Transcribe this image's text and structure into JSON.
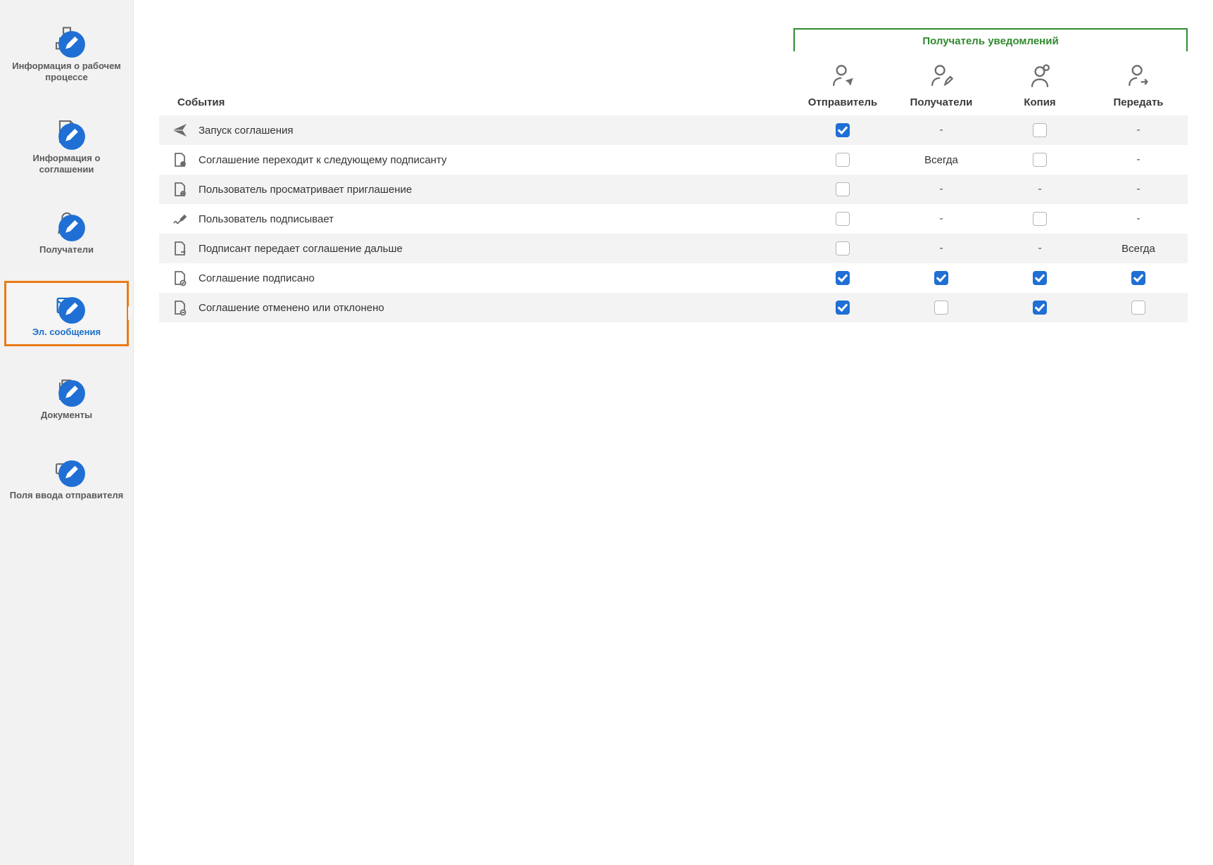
{
  "sidebar": {
    "items": [
      {
        "id": "workflow-info",
        "label": "Информация о рабочем процессе"
      },
      {
        "id": "agreement-info",
        "label": "Информация о соглашении"
      },
      {
        "id": "recipients",
        "label": "Получатели"
      },
      {
        "id": "emails",
        "label": "Эл. сообщения",
        "active": true
      },
      {
        "id": "documents",
        "label": "Документы"
      },
      {
        "id": "sender-fields",
        "label": "Поля ввода отправителя"
      }
    ]
  },
  "table": {
    "recipient_group_label": "Получатель уведомлений",
    "events_header": "События",
    "columns": [
      {
        "id": "sender",
        "label": "Отправитель"
      },
      {
        "id": "recipients",
        "label": "Получатели"
      },
      {
        "id": "cc",
        "label": "Копия"
      },
      {
        "id": "forward",
        "label": "Передать"
      }
    ],
    "always_text": "Всегда",
    "rows": [
      {
        "icon": "send",
        "label": "Запуск соглашения",
        "cells": [
          {
            "type": "checkbox",
            "checked": true
          },
          {
            "type": "dash"
          },
          {
            "type": "checkbox",
            "checked": false
          },
          {
            "type": "dash"
          }
        ]
      },
      {
        "icon": "next-signer",
        "label": "Соглашение переходит к следующему подписанту",
        "cells": [
          {
            "type": "checkbox",
            "checked": false
          },
          {
            "type": "text",
            "value": "Всегда"
          },
          {
            "type": "checkbox",
            "checked": false
          },
          {
            "type": "dash"
          }
        ]
      },
      {
        "icon": "view",
        "label": "Пользователь просматривает приглашение",
        "cells": [
          {
            "type": "checkbox",
            "checked": false
          },
          {
            "type": "dash"
          },
          {
            "type": "dash"
          },
          {
            "type": "dash"
          }
        ]
      },
      {
        "icon": "sign",
        "label": "Пользователь подписывает",
        "cells": [
          {
            "type": "checkbox",
            "checked": false
          },
          {
            "type": "dash"
          },
          {
            "type": "checkbox",
            "checked": false
          },
          {
            "type": "dash"
          }
        ]
      },
      {
        "icon": "delegate",
        "label": "Подписант передает соглашение дальше",
        "cells": [
          {
            "type": "checkbox",
            "checked": false
          },
          {
            "type": "dash"
          },
          {
            "type": "dash"
          },
          {
            "type": "text",
            "value": "Всегда"
          }
        ]
      },
      {
        "icon": "signed",
        "label": "Соглашение подписано",
        "cells": [
          {
            "type": "checkbox",
            "checked": true
          },
          {
            "type": "checkbox",
            "checked": true
          },
          {
            "type": "checkbox",
            "checked": true
          },
          {
            "type": "checkbox",
            "checked": true
          }
        ]
      },
      {
        "icon": "cancelled",
        "label": "Соглашение отменено или отклонено",
        "cells": [
          {
            "type": "checkbox",
            "checked": true
          },
          {
            "type": "checkbox",
            "checked": false
          },
          {
            "type": "checkbox",
            "checked": true
          },
          {
            "type": "checkbox",
            "checked": false
          }
        ]
      }
    ]
  }
}
